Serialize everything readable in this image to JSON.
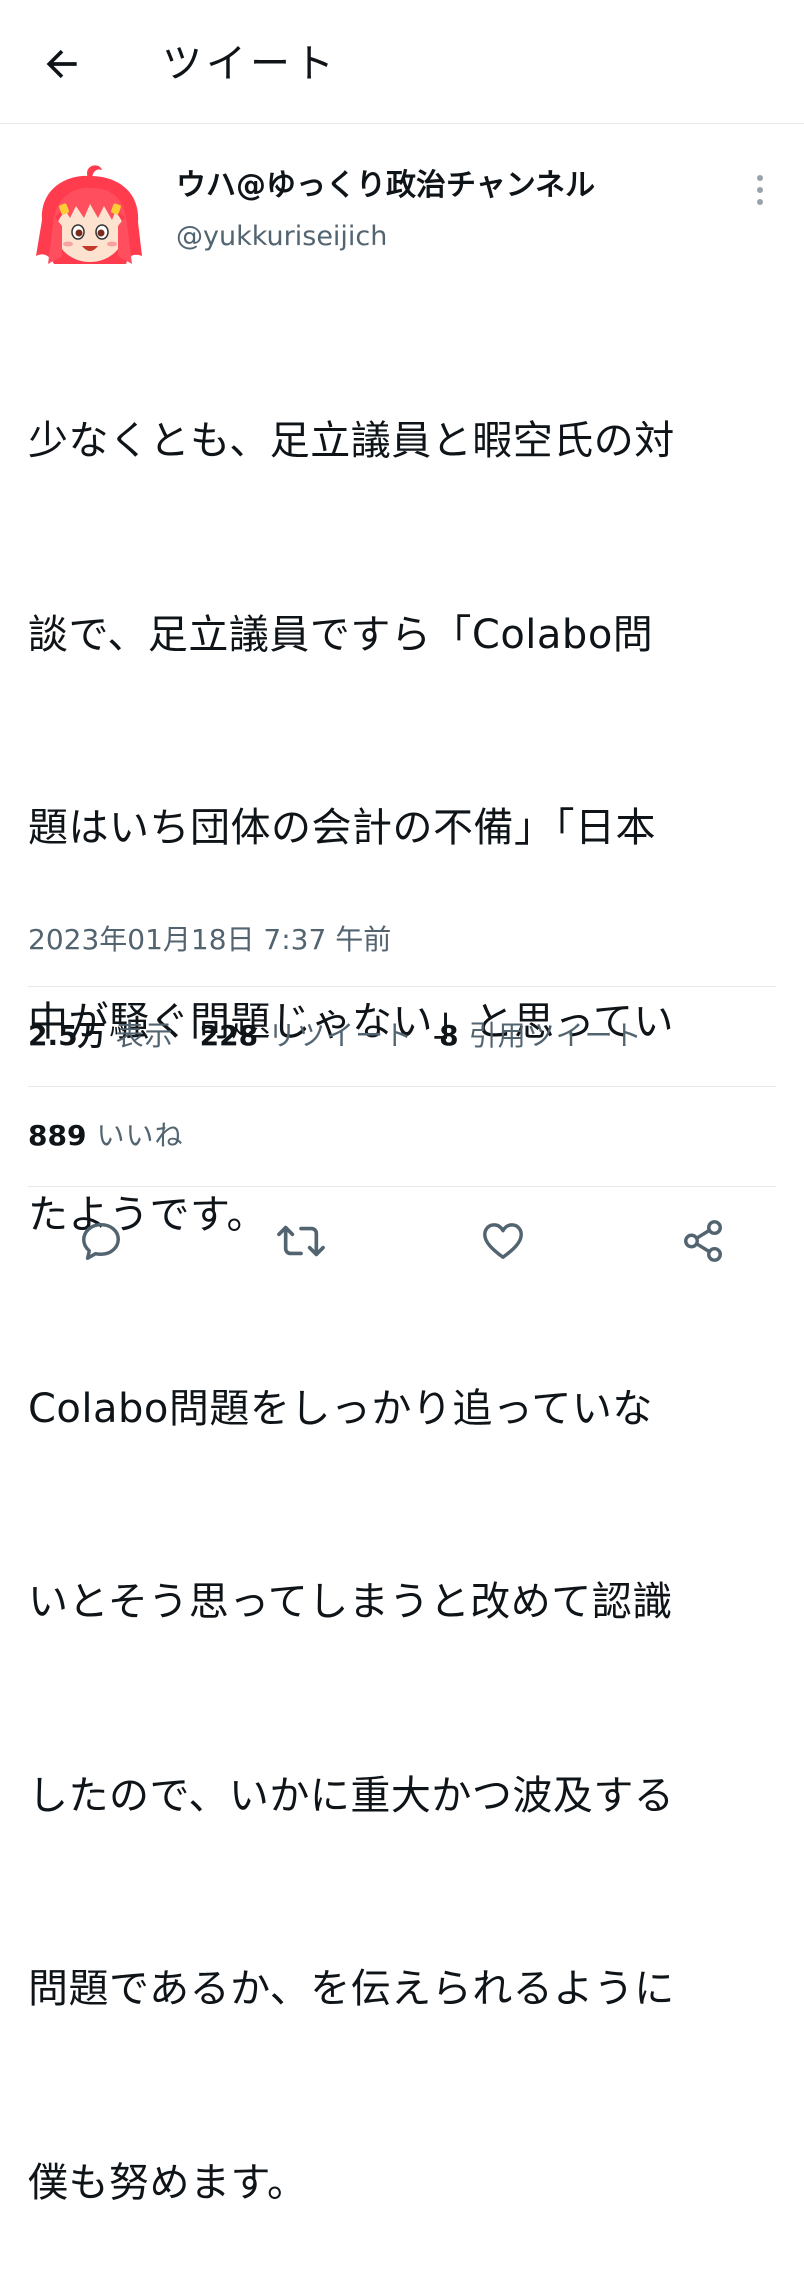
{
  "header": {
    "title": "ツイート",
    "back_icon": "arrow-left-icon"
  },
  "author": {
    "display_name": "ウハ@ゆっくり政治チャンネル",
    "handle": "@yukkuriseijich",
    "avatar": "red-haired-yukkuri-avatar"
  },
  "tweet": {
    "text_lines": [
      "少なくとも、足立議員と暇空氏の対",
      "談で、足立議員ですら「Colabo問",
      "題はいち団体の会計の不備」「日本",
      "中が騒ぐ問題じゃない」と思ってい",
      "たようです。",
      "Colabo問題をしっかり追っていな",
      "いとそう思ってしまうと改めて認識",
      "したので、いかに重大かつ波及する",
      "問題であるか、を伝えられるように",
      "僕も努めます。"
    ],
    "timestamp": "2023年01月18日 7:37 午前"
  },
  "stats": {
    "views_num": "2.5万",
    "views_label": "表示",
    "retweets_num": "228",
    "retweets_label": "リツイート",
    "quotes_num": "8",
    "quotes_label": "引用ツイート",
    "likes_num": "889",
    "likes_label": "いいね"
  },
  "actions": {
    "reply_icon": "reply-icon",
    "retweet_icon": "retweet-icon",
    "like_icon": "heart-icon",
    "share_icon": "share-icon"
  },
  "colors": {
    "text": "#0f1419",
    "secondary": "#536471",
    "divider": "#e6e9eb",
    "avatar_hair": "#ff3b4e"
  }
}
